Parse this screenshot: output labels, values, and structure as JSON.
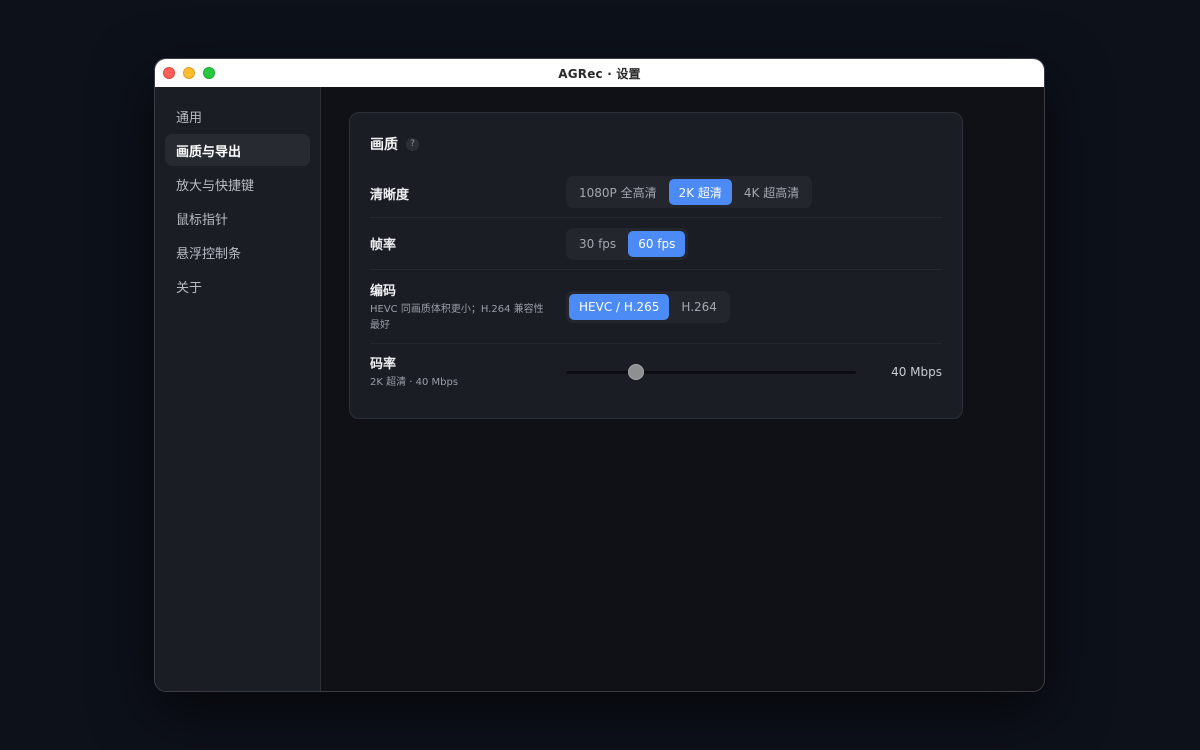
{
  "window": {
    "title": "AGRec · 设置"
  },
  "sidebar": {
    "items": [
      {
        "label": "通用",
        "active": false
      },
      {
        "label": "画质与导出",
        "active": true
      },
      {
        "label": "放大与快捷键",
        "active": false
      },
      {
        "label": "鼠标指针",
        "active": false
      },
      {
        "label": "悬浮控制条",
        "active": false
      },
      {
        "label": "关于",
        "active": false
      }
    ]
  },
  "card": {
    "title": "画质",
    "help_glyph": "?",
    "resolution": {
      "label": "清晰度",
      "options": [
        "1080P 全高清",
        "2K 超清",
        "4K 超高清"
      ],
      "selected": "2K 超清"
    },
    "framerate": {
      "label": "帧率",
      "options": [
        "30 fps",
        "60 fps"
      ],
      "selected": "60 fps"
    },
    "codec": {
      "label": "编码",
      "sublabel": "HEVC 同画质体积更小；H.264 兼容性最好",
      "options": [
        "HEVC / H.265",
        "H.264"
      ],
      "selected": "HEVC / H.265"
    },
    "bitrate": {
      "label": "码率",
      "sublabel": "2K 超清 · 40 Mbps",
      "value_text": "40 Mbps",
      "slider_fraction": 0.225
    }
  },
  "colors": {
    "accent": "#4c8bf5",
    "window_bg": "#0f1116",
    "sidebar_bg": "#1a1d24",
    "card_bg": "#1a1d24"
  },
  "icons": {
    "help": "question-circle-icon",
    "close": "close-dot-icon",
    "minimize": "minimize-dot-icon",
    "zoom": "zoom-dot-icon"
  }
}
